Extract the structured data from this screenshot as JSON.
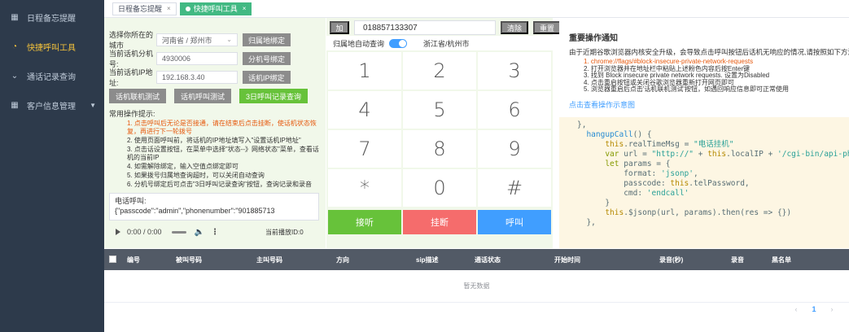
{
  "sidebar": {
    "items": [
      {
        "label": "日程备忘提醒",
        "icon": "calendar-icon"
      },
      {
        "label": "快捷呼叫工具",
        "icon": "dashboard-icon",
        "active": true
      },
      {
        "label": "通话记录查询",
        "icon": "chevron-down-icon"
      },
      {
        "label": "客户信息管理",
        "icon": "grid-icon"
      }
    ]
  },
  "tabs": [
    {
      "label": "日程备忘提醒"
    },
    {
      "label": "快捷呼叫工具",
      "active": true
    }
  ],
  "config": {
    "city_label": "选择你所在的城市",
    "city_value": "河南省 / 郑州市",
    "bind_city_btn": "归属地绑定",
    "ext_label": "当前话机分机号:",
    "ext_value": "4930006",
    "bind_ext_btn": "分机号绑定",
    "ip_label": "当前话机IP地址:",
    "ip_value": "192.168.3.40",
    "bind_ip_btn": "话机IP绑定",
    "test_link_btn": "话机联机测试",
    "test_call_btn": "话机呼叫测试",
    "records_btn": "3日呼叫记录查询",
    "tips_title": "常用操作提示:",
    "tips": [
      "1. 点击呼叫后无论是否接通，请在结束后点击挂断，使话机状态恢复，再进行下一轮拨号",
      "2. 使用页面呼叫前，将话机的IP地址填写入\"设置话机IP地址\"",
      "3. 点击话设置按钮，在菜单中选择\"状态--》网络状态\"菜单，查看话机的当前IP",
      "4. 如需解除绑定，输入空值点绑定即可",
      "5. 如果拨号归属地查询超时，可以关闭自动查询",
      "6. 分机号绑定后可点击\"3日呼叫记录查询\"按钮，查询记录和录音"
    ],
    "log_line1": "电话呼叫:",
    "log_line2": "{\"passcode\":\"admin\",\"phonenumber\":\"901885713",
    "audio_time": "0:00 / 0:00",
    "play_id": "当前播放ID:0"
  },
  "dialer": {
    "add_btn": "加",
    "phone_value": "018857133307",
    "clear_btn": "清除",
    "reset_btn": "重置",
    "auto_query_label": "归属地自动查询",
    "location": "浙江省/杭州市",
    "keys": [
      "1",
      "2",
      "3",
      "4",
      "5",
      "6",
      "7",
      "8",
      "9",
      "*",
      "0",
      "#"
    ],
    "answer_btn": "接听",
    "hangup_btn": "挂断",
    "call_btn": "呼叫"
  },
  "notice": {
    "title": "重要操作通知",
    "desc": "由于近期谷歌浏览器内核安全升级，会导致点击呼叫按钮后话机无响应的情况,请按照如下方法设置浏览器：",
    "steps": [
      "1. chrome://flags/#block-insecure-private-network-requests",
      "2. 打开浏览器并在地址栏中粘贴上述粉色内容后按Enter键",
      "3. 找到 Block insecure private network requests. 设置为Disabled",
      "4. 点击重启按钮或关闭谷歌浏览器重新打开网页即可",
      "5. 浏览器重启后点击'话机联机测试'按钮，如遇回响应信息即可正常使用"
    ],
    "link": "点击查看操作示意图"
  },
  "code": {
    "line0": "},",
    "fn": "hangupCall",
    "rtm": "电话挂机",
    "url_a": "\"http://\"",
    "url_b": "'/cgi-bin/api-phone_",
    "fmt": "'jsonp'",
    "cmd": "'endcall'"
  },
  "table": {
    "headers": [
      "编号",
      "被叫号码",
      "主叫号码",
      "方向",
      "sip描述",
      "通话状态",
      "开始时间",
      "录音(秒)",
      "录音",
      "黑名单"
    ],
    "empty_text": "暂无数据",
    "page": "1"
  }
}
